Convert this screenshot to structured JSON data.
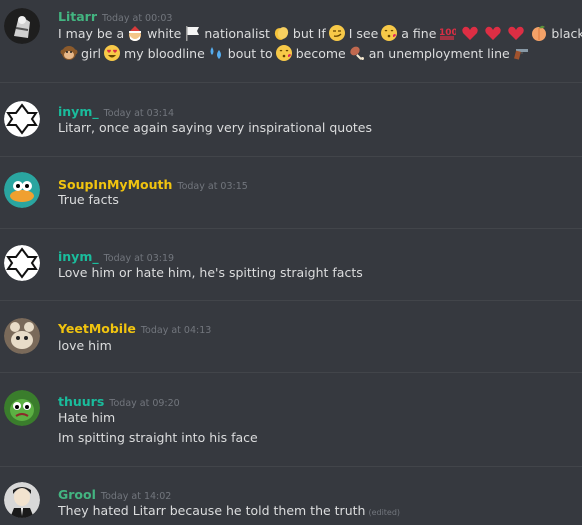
{
  "colors": {
    "background": "#36393f",
    "text": "#dcddde",
    "timestamp": "#72767d",
    "separator": "#42454a",
    "name_litarr": "#43b581",
    "name_inym": "#1abc9c",
    "name_soup": "#f1c40f",
    "name_yeet": "#f1c40f",
    "name_thuurs": "#1abc9c",
    "name_grool": "#43b581"
  },
  "messages": [
    {
      "author": "Litarr",
      "timestamp": "Today at 00:03",
      "avatar": "litarr-avatar",
      "lines": [
        {
          "parts": [
            {
              "t": "I may be a"
            },
            {
              "icon": "santa-emoji"
            },
            {
              "t": "white"
            },
            {
              "icon": "white-flag-emoji"
            },
            {
              "t": "nationalist"
            },
            {
              "icon": "clap-emoji"
            },
            {
              "t": "but If"
            },
            {
              "icon": "smirk-emoji"
            },
            {
              "t": "I see"
            },
            {
              "icon": "kissing-emoji"
            },
            {
              "t": "a fine"
            },
            {
              "icon": "hundred-emoji"
            },
            {
              "icon": "heart-emoji"
            },
            {
              "icon": "heart-emoji"
            },
            {
              "icon": "heart-emoji"
            },
            {
              "icon": "peach-emoji"
            },
            {
              "t": "black"
            }
          ]
        },
        {
          "parts": [
            {
              "icon": "monkey-emoji"
            },
            {
              "t": "girl"
            },
            {
              "icon": "heart-eyes-emoji"
            },
            {
              "t": "my bloodline"
            },
            {
              "icon": "sweat-drops-emoji"
            },
            {
              "t": "bout to"
            },
            {
              "icon": "kissing-emoji"
            },
            {
              "t": "become"
            },
            {
              "icon": "drumstick-emoji"
            },
            {
              "t": "an unemployment line"
            },
            {
              "icon": "gun-emoji"
            }
          ]
        }
      ]
    },
    {
      "author": "inym_",
      "timestamp": "Today at 03:14",
      "avatar": "inym-avatar",
      "lines": [
        {
          "text": "Litarr, once again saying very inspirational quotes"
        }
      ]
    },
    {
      "author": "SoupInMyMouth",
      "timestamp": "Today at 03:15",
      "avatar": "soup-avatar",
      "lines": [
        {
          "text": "True facts"
        }
      ]
    },
    {
      "author": "inym_",
      "timestamp": "Today at 03:19",
      "avatar": "inym-avatar",
      "lines": [
        {
          "text": "Love him or hate him, he's spitting straight facts"
        }
      ]
    },
    {
      "author": "YeetMobile",
      "timestamp": "Today at 04:13",
      "avatar": "yeet-avatar",
      "lines": [
        {
          "text": "love him"
        }
      ]
    },
    {
      "author": "thuurs",
      "timestamp": "Today at 09:20",
      "avatar": "thuurs-avatar",
      "lines": [
        {
          "text": "Hate him"
        },
        {
          "text": "Im spitting straight into his face"
        }
      ]
    },
    {
      "author": "Grool",
      "timestamp": "Today at 14:02",
      "avatar": "grool-avatar",
      "lines": [
        {
          "text": "They hated Litarr because he told them the truth",
          "edited": "(edited)"
        }
      ]
    }
  ]
}
